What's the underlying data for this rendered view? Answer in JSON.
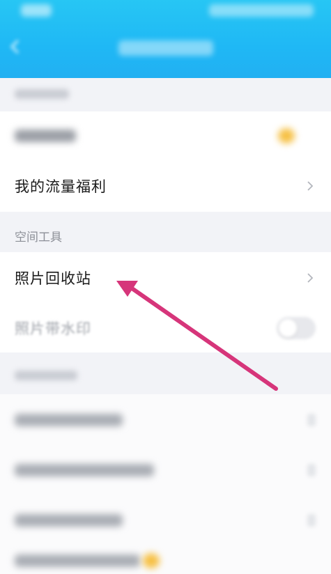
{
  "rows": {
    "traffic_welfare": "我的流量福利",
    "photo_recycle": "照片回收站",
    "photo_watermark": "照片带水印"
  },
  "sections": {
    "space_tools": "空间工具"
  },
  "annotation": {
    "arrow_color": "#d6357a",
    "target": "照片回收站"
  },
  "colors": {
    "header": "#22b8f4",
    "background": "#f2f3f7",
    "card": "#ffffff"
  }
}
